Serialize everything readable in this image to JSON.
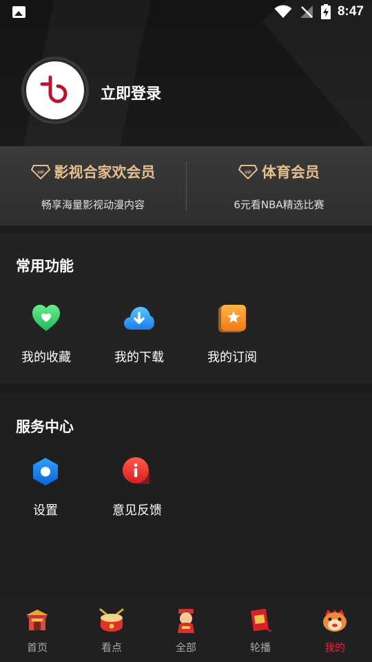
{
  "status_bar": {
    "time": "8:47"
  },
  "profile": {
    "login_text": "立即登录"
  },
  "vip": [
    {
      "title": "影视合家欢会员",
      "subtitle": "畅享海量影视动漫内容"
    },
    {
      "title": "体育会员",
      "subtitle": "6元看NBA精选比赛"
    }
  ],
  "common_functions": {
    "title": "常用功能",
    "items": [
      {
        "label": "我的收藏",
        "icon": "heart-icon"
      },
      {
        "label": "我的下载",
        "icon": "cloud-download-icon"
      },
      {
        "label": "我的订阅",
        "icon": "star-icon"
      }
    ]
  },
  "service_center": {
    "title": "服务中心",
    "items": [
      {
        "label": "设置",
        "icon": "settings-icon"
      },
      {
        "label": "意见反馈",
        "icon": "feedback-icon"
      }
    ]
  },
  "tab_bar": {
    "active": "我的",
    "items": [
      {
        "label": "首页",
        "icon": "home-icon"
      },
      {
        "label": "看点",
        "icon": "drum-icon"
      },
      {
        "label": "全部",
        "icon": "all-icon"
      },
      {
        "label": "轮播",
        "icon": "carousel-icon"
      },
      {
        "label": "我的",
        "icon": "profile-icon"
      }
    ]
  },
  "colors": {
    "accent": "#e9233a",
    "vip_gold": "#e7bf8e",
    "background": "#1c1c1d"
  }
}
